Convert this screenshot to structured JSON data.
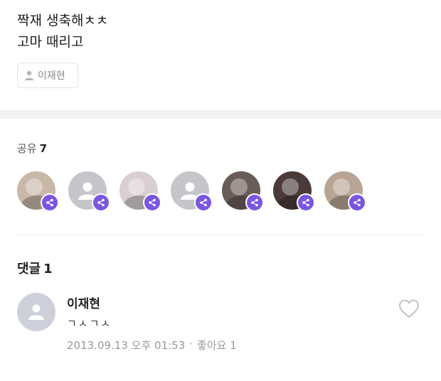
{
  "post": {
    "line1": "짝재 생축해ㅊㅊ",
    "line2": "고마 때리고",
    "tag_label": "이재현"
  },
  "share": {
    "label": "공유",
    "count": "7",
    "avatars": [
      {
        "name": "share-avatar-1",
        "type": "photo",
        "bg": "#c9b7a8"
      },
      {
        "name": "share-avatar-2",
        "type": "default",
        "bg": "#c5c6ca"
      },
      {
        "name": "share-avatar-3",
        "type": "photo",
        "bg": "#d9cfd2"
      },
      {
        "name": "share-avatar-4",
        "type": "default",
        "bg": "#c5c6ca"
      },
      {
        "name": "share-avatar-5",
        "type": "photo",
        "bg": "#6a5c58"
      },
      {
        "name": "share-avatar-6",
        "type": "photo",
        "bg": "#4a3b3a"
      },
      {
        "name": "share-avatar-7",
        "type": "photo",
        "bg": "#b9a595"
      }
    ],
    "badge_color": "#7a56e0"
  },
  "comments": {
    "label": "댓글",
    "count": "1",
    "items": [
      {
        "author": "이재현",
        "body": "ㄱㅅㄱㅅ",
        "timestamp": "2013.09.13 오후 01:53",
        "separator": "·",
        "likes": "좋아요 1"
      }
    ]
  }
}
